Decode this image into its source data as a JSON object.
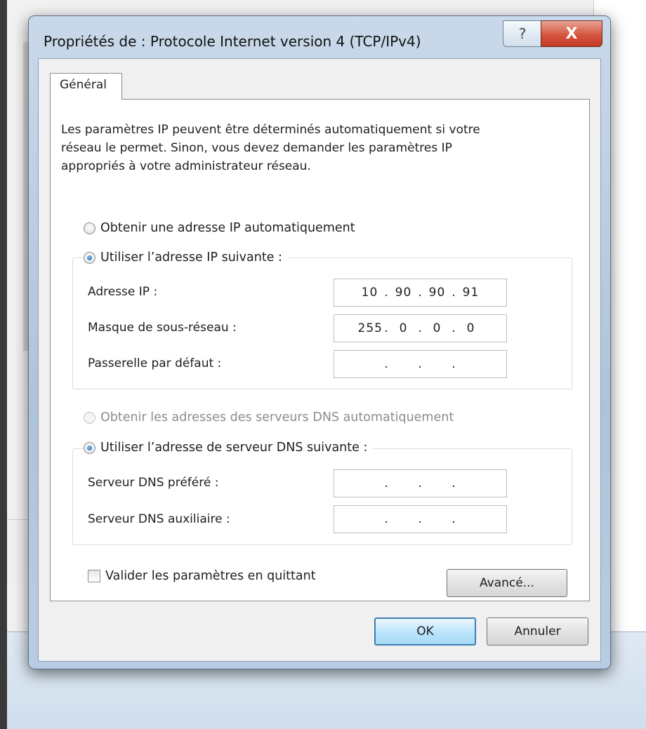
{
  "dialog": {
    "title": "Propriétés de : Protocole Internet version 4 (TCP/IPv4)",
    "help_glyph": "?",
    "close_glyph": "X",
    "tab_label": "Général",
    "intro_text": "Les paramètres IP peuvent être déterminés automatiquement si votre\nréseau le permet. Sinon, vous devez demander les paramètres IP\nappropriés à votre administrateur réseau.",
    "ip": {
      "auto_label": "Obtenir une adresse IP automatiquement",
      "manual_label": "Utiliser l’adresse IP suivante :",
      "selected": "manual",
      "fields": [
        {
          "label": "Adresse IP :",
          "octets": [
            "10",
            "90",
            "90",
            "91"
          ]
        },
        {
          "label": "Masque de sous-réseau :",
          "octets": [
            "255",
            "0",
            "0",
            "0"
          ]
        },
        {
          "label": "Passerelle par défaut :",
          "octets": [
            "",
            "",
            "",
            ""
          ]
        }
      ]
    },
    "dns": {
      "auto_label": "Obtenir les adresses des serveurs DNS automatiquement",
      "auto_disabled": true,
      "manual_label": "Utiliser l’adresse de serveur DNS suivante :",
      "selected": "manual",
      "fields": [
        {
          "label": "Serveur DNS préféré :",
          "octets": [
            "",
            "",
            "",
            ""
          ]
        },
        {
          "label": "Serveur DNS auxiliaire :",
          "octets": [
            "",
            "",
            "",
            ""
          ]
        }
      ]
    },
    "validate_label": "Valider les paramètres en quittant",
    "validate_checked": false,
    "advanced_label": "Avancé...",
    "ok_label": "OK",
    "cancel_label": "Annuler"
  },
  "colors": {
    "title_bar": "#aec3da",
    "close_button": "#d5553f",
    "default_button_border": "#3c7fb1"
  }
}
